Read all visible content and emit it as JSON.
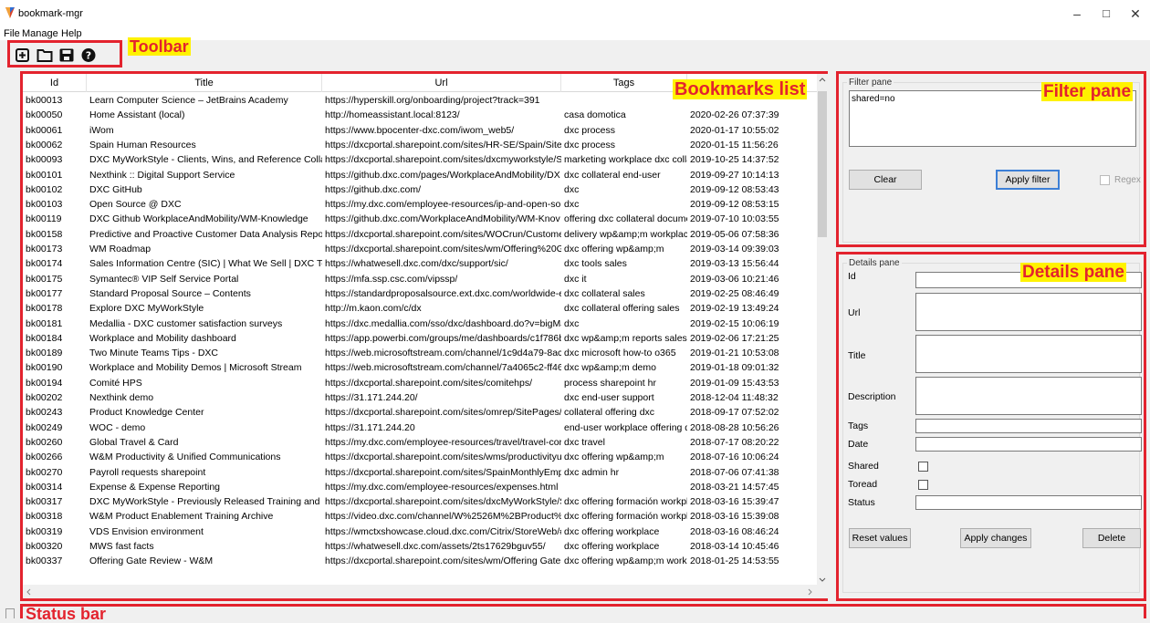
{
  "window": {
    "title": "bookmark-mgr",
    "controls": {
      "minimize": "–",
      "maximize": "□",
      "close": "✕"
    }
  },
  "menu": [
    "File",
    "Manage",
    "Help"
  ],
  "toolbar": {
    "buttons": [
      "new-file-icon",
      "open-folder-icon",
      "save-icon",
      "help-icon"
    ]
  },
  "callouts": {
    "toolbar": "Toolbar",
    "bookmarks_list": "Bookmarks list",
    "filter_pane": "Filter pane",
    "details_pane": "Details pane",
    "status_bar": "Status bar"
  },
  "colors": {
    "callout_border": "#e3232e",
    "callout_highlight": "#fff200",
    "focus": "#3c7fd6"
  },
  "bookmarks": {
    "columns": [
      "Id",
      "Title",
      "Url",
      "Tags",
      ""
    ],
    "rows": [
      [
        "bk00013",
        "Learn Computer Science – JetBrains Academy",
        "https://hyperskill.org/onboarding/project?track=391",
        "",
        ""
      ],
      [
        "bk00050",
        "Home Assistant (local)",
        "http://homeassistant.local:8123/",
        "casa domotica",
        "2020-02-26 07:37:39"
      ],
      [
        "bk00061",
        "iWom",
        "https://www.bpocenter-dxc.com/iwom_web5/",
        "dxc process",
        "2020-01-17 10:55:02"
      ],
      [
        "bk00062",
        "Spain Human Resources",
        "https://dxcportal.sharepoint.com/sites/HR-SE/Spain/SiteP.",
        "dxc process",
        "2020-01-15 11:56:26"
      ],
      [
        "bk00093",
        "DXC MyWorkStyle - Clients, Wins, and Reference Collateral",
        "https://dxcportal.sharepoint.com/sites/dxcmyworkstyle/Si",
        "marketing workplace dxc colla",
        "2019-10-25 14:37:52"
      ],
      [
        "bk00101",
        "Nexthink :: Digital Support Service",
        "https://github.dxc.com/pages/WorkplaceAndMobility/DX",
        "dxc collateral end-user",
        "2019-09-27 10:14:13"
      ],
      [
        "bk00102",
        "DXC GitHub",
        "https://github.dxc.com/",
        "dxc",
        "2019-09-12 08:53:43"
      ],
      [
        "bk00103",
        "Open Source @ DXC",
        "https://my.dxc.com/employee-resources/ip-and-open-so",
        "dxc",
        "2019-09-12 08:53:15"
      ],
      [
        "bk00119",
        "DXC Github WorkplaceAndMobility/WM-Knowledge",
        "https://github.dxc.com/WorkplaceAndMobility/WM-Knov",
        "offering dxc collateral docume",
        "2019-07-10 10:03:55"
      ],
      [
        "bk00158",
        "Predictive and Proactive Customer Data Analysis Reports",
        "https://dxcportal.sharepoint.com/sites/WOCrun/Custome",
        "delivery wp&amp;m workplac",
        "2019-05-06 07:58:36"
      ],
      [
        "bk00173",
        "WM Roadmap",
        "https://dxcportal.sharepoint.com/sites/wm/Offering%20G",
        "dxc offering wp&amp;m",
        "2019-03-14 09:39:03"
      ],
      [
        "bk00174",
        "Sales Information Centre (SIC) | What We Sell | DXC Techno",
        "https://whatwesell.dxc.com/dxc/support/sic/",
        "dxc tools sales",
        "2019-03-13 15:56:44"
      ],
      [
        "bk00175",
        "Symantec® VIP Self Service Portal",
        "https://mfa.ssp.csc.com/vipssp/",
        "dxc it",
        "2019-03-06 10:21:46"
      ],
      [
        "bk00177",
        "Standard Proposal Source – Contents",
        "https://standardproposalsource.ext.dxc.com/worldwide-er",
        "dxc collateral sales",
        "2019-02-25 08:46:49"
      ],
      [
        "bk00178",
        "Explore DXC MyWorkStyle",
        "http://m.kaon.com/c/dx",
        "dxc collateral offering sales",
        "2019-02-19 13:49:24"
      ],
      [
        "bk00181",
        "Medallia - DXC customer satisfaction surveys",
        "https://dxc.medallia.com/sso/dxc/dashboard.do?v=bigMJ",
        "dxc",
        "2019-02-15 10:06:19"
      ],
      [
        "bk00184",
        "Workplace and Mobility dashboard",
        "https://app.powerbi.com/groups/me/dashboards/c1f786b",
        "dxc wp&amp;m reports sales",
        "2019-02-06 17:21:25"
      ],
      [
        "bk00189",
        "Two Minute Teams Tips - DXC",
        "https://web.microsoftstream.com/channel/1c9d4a79-8ac0",
        "dxc microsoft how-to o365",
        "2019-01-21 10:53:08"
      ],
      [
        "bk00190",
        "Workplace and Mobility Demos | Microsoft Stream",
        "https://web.microsoftstream.com/channel/7a4065c2-ff46-",
        "dxc wp&amp;m demo",
        "2019-01-18 09:01:32"
      ],
      [
        "bk00194",
        "Comité HPS",
        "https://dxcportal.sharepoint.com/sites/comitehps/",
        "process sharepoint hr",
        "2019-01-09 15:43:53"
      ],
      [
        "bk00202",
        "Nexthink demo",
        "https://31.171.244.20/",
        "dxc end-user support",
        "2018-12-04 11:48:32"
      ],
      [
        "bk00243",
        "Product Knowledge Center",
        "https://dxcportal.sharepoint.com/sites/omrep/SitePages/F",
        "collateral offering dxc",
        "2018-09-17 07:52:02"
      ],
      [
        "bk00249",
        "WOC - demo",
        "https://31.171.244.20",
        "end-user workplace offering d",
        "2018-08-28 10:56:26"
      ],
      [
        "bk00260",
        "Global Travel & Card",
        "https://my.dxc.com/employee-resources/travel/travel-cor",
        "dxc travel",
        "2018-07-17 08:20:22"
      ],
      [
        "bk00266",
        "W&M Productivity & Unified Communications",
        "https://dxcportal.sharepoint.com/sites/wms/productivityu",
        "dxc offering wp&amp;m",
        "2018-07-16 10:06:24"
      ],
      [
        "bk00270",
        "Payroll requests sharepoint",
        "https://dxcportal.sharepoint.com/sites/SpainMonthlyEmpl",
        "dxc admin hr",
        "2018-07-06 07:41:38"
      ],
      [
        "bk00314",
        "Expense & Expense Reporting",
        "https://my.dxc.com/employee-resources/expenses.html",
        "",
        "2018-03-21 14:57:45"
      ],
      [
        "bk00317",
        "DXC MyWorkStyle - Previously Released Training and Colla",
        "https://dxcportal.sharepoint.com/sites/dxcMyWorkStyle/S",
        "dxc offering formación workpl",
        "2018-03-16 15:39:47"
      ],
      [
        "bk00318",
        "W&M Product Enablement Training Archive",
        "https://video.dxc.com/channel/W%2526M%2BProduct%2I",
        "dxc offering formación workpl",
        "2018-03-16 15:39:08"
      ],
      [
        "bk00319",
        "VDS Envision environment",
        "https://wmctxshowcase.cloud.dxc.com/Citrix/StoreWeb/#/log",
        "dxc offering workplace",
        "2018-03-16 08:46:24"
      ],
      [
        "bk00320",
        "MWS fast facts",
        "https://whatwesell.dxc.com/assets/2ts17629bguv55/",
        "dxc offering workplace",
        "2018-03-14 10:45:46"
      ],
      [
        "bk00337",
        "Offering Gate Review - W&M",
        "https://dxcportal.sharepoint.com/sites/wm/Offering Gate",
        "dxc offering wp&amp;m work",
        "2018-01-25 14:53:55"
      ]
    ]
  },
  "filter": {
    "group_title": "Filter pane",
    "text": "shared=no",
    "clear_label": "Clear",
    "apply_label": "Apply filter",
    "regex_label": "Regex"
  },
  "details": {
    "group_title": "Details pane",
    "labels": {
      "id": "Id",
      "url": "Url",
      "title": "Title",
      "description": "Description",
      "tags": "Tags",
      "date": "Date",
      "shared": "Shared",
      "toread": "Toread",
      "status": "Status"
    },
    "reset_label": "Reset values",
    "apply_label": "Apply changes",
    "delete_label": "Delete"
  }
}
